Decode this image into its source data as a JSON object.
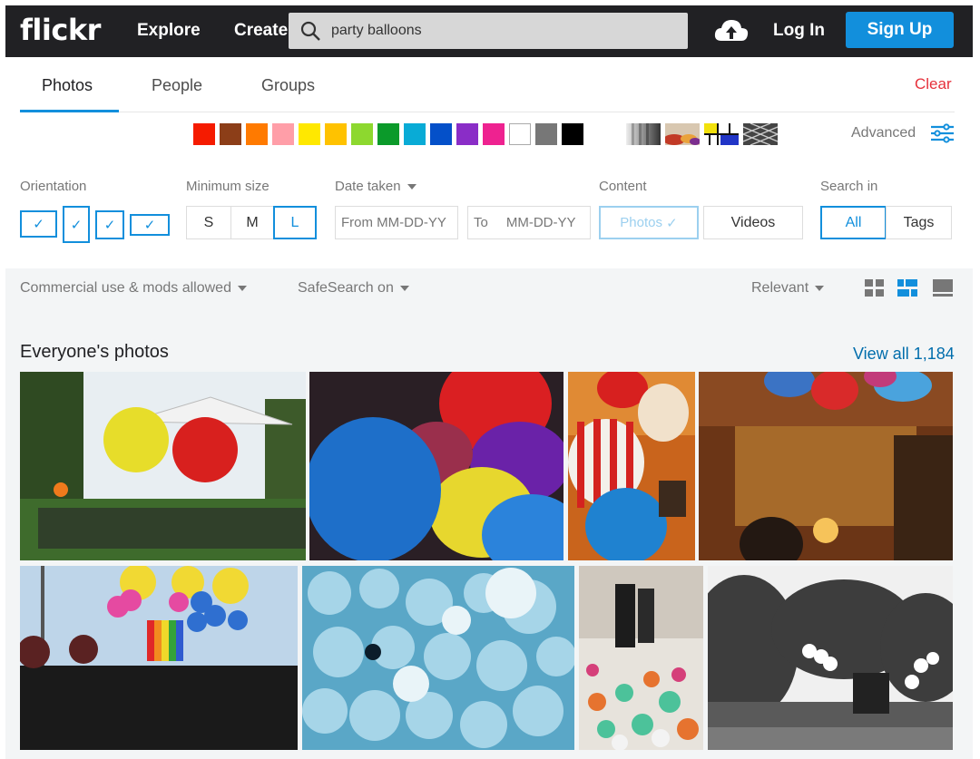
{
  "header": {
    "logo": "flickr",
    "nav": [
      "Explore",
      "Create"
    ],
    "search_value": "party balloons",
    "login": "Log In",
    "signup": "Sign Up"
  },
  "tabs": [
    {
      "label": "Photos",
      "active": true
    },
    {
      "label": "People",
      "active": false
    },
    {
      "label": "Groups",
      "active": false
    }
  ],
  "clear_label": "Clear",
  "color_swatches": [
    "#f51b00",
    "#8c3e18",
    "#ff7a00",
    "#ff9ea8",
    "#ffe800",
    "#ffc200",
    "#8dd82f",
    "#0b9a2a",
    "#09abd6",
    "#0450c9",
    "#8a2dc7",
    "#ee2290",
    "#ffffff",
    "#777777",
    "#000000"
  ],
  "style_filters": [
    "black-and-white",
    "shallow-depth-of-field",
    "minimalist",
    "patterns"
  ],
  "advanced_label": "Advanced",
  "filters": {
    "orientation_label": "Orientation",
    "minsize_label": "Minimum size",
    "size_options": [
      "S",
      "M",
      "L"
    ],
    "size_selected": "L",
    "date_label": "Date taken",
    "date_from_prefix": "From",
    "date_from_placeholder": "MM-DD-YY",
    "date_to_prefix": "To",
    "date_to_placeholder": "MM-DD-YY",
    "content_label": "Content",
    "content_options": [
      "Photos",
      "Videos"
    ],
    "searchin_label": "Search in",
    "searchin_options": [
      "All",
      "Tags"
    ],
    "searchin_selected": "All"
  },
  "subfilters": {
    "license": "Commercial use & mods allowed",
    "safesearch": "SafeSearch on",
    "sort": "Relevant"
  },
  "section": {
    "title": "Everyone's photos",
    "view_all": "View all 1,184"
  },
  "accent": "#128fdc"
}
